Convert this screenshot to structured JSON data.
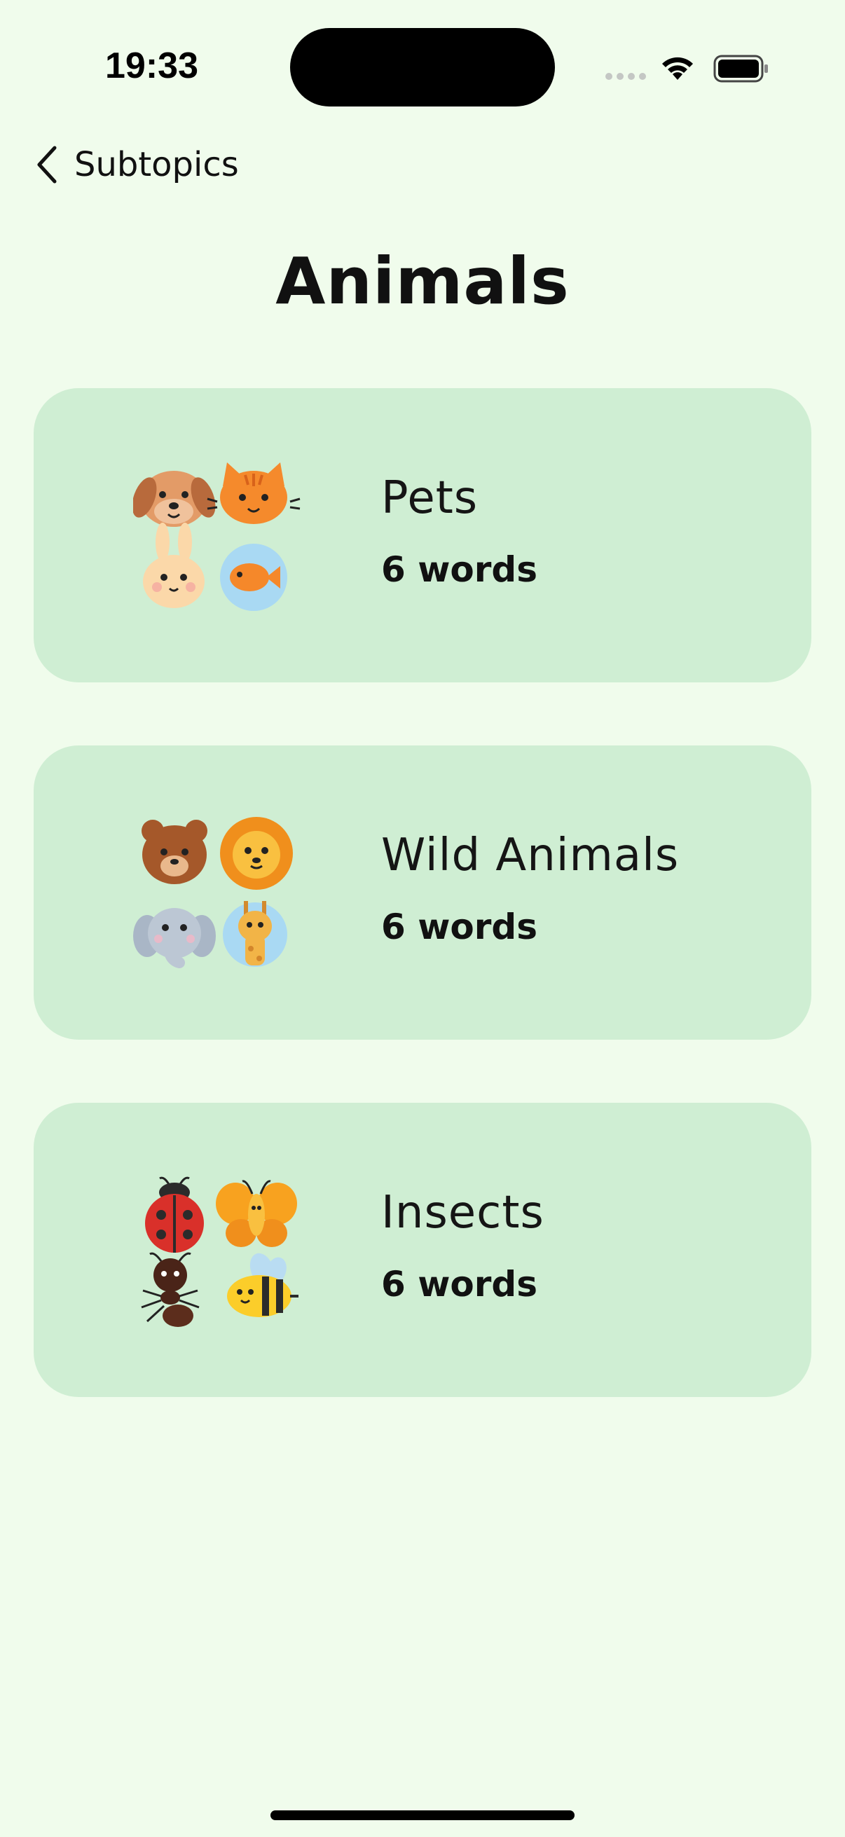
{
  "status": {
    "time": "19:33"
  },
  "nav": {
    "back_label": "Subtopics"
  },
  "page": {
    "title": "Animals"
  },
  "subtopics": [
    {
      "name": "Pets",
      "count": "6 words",
      "icons": [
        "dog-face",
        "cat-face",
        "rabbit-face",
        "goldfish"
      ]
    },
    {
      "name": "Wild Animals",
      "count": "6 words",
      "icons": [
        "bear-face",
        "lion-face",
        "elephant-face",
        "giraffe"
      ]
    },
    {
      "name": "Insects",
      "count": "6 words",
      "icons": [
        "ladybug",
        "butterfly",
        "ant",
        "bee"
      ]
    }
  ],
  "colors": {
    "background": "#f0fcec",
    "card": "#cfeed3",
    "text": "#111111"
  }
}
